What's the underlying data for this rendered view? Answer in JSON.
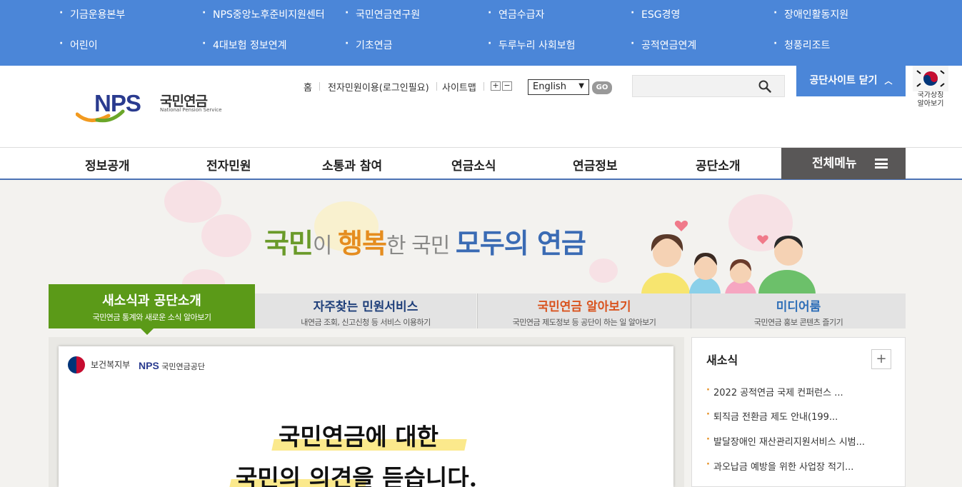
{
  "top_sites": [
    [
      "기금운용본부",
      "NPS중앙노후준비지원센터",
      "국민연금연구원",
      "연금수급자",
      "ESG경영",
      "장애인활동지원"
    ],
    [
      "어린이",
      "4대보험 정보연계",
      "기초연금",
      "두루누리 사회보험",
      "공적연금연계",
      "청풍리조트"
    ]
  ],
  "logo": {
    "nps": "NPS",
    "kr": "국민연금",
    "en": "National Pension Service"
  },
  "util": {
    "home": "홈",
    "eservice": "전자민원이용(로그인필요)",
    "sitemap": "사이트맵",
    "font_plus": "+",
    "font_minus": "−",
    "language": "English",
    "go": "GO",
    "close_site": "공단사이트 닫기",
    "symbol_line1": "국가상징",
    "symbol_line2": "알아보기"
  },
  "gnb": [
    "정보공개",
    "전자민원",
    "소통과 참여",
    "연금소식",
    "연금정보",
    "공단소개"
  ],
  "all_menu": "전체메뉴",
  "slogan": {
    "p1": "국민",
    "p2": "이 ",
    "p3": "행복",
    "p4": "한 국민 ",
    "p5": "모두의 연금"
  },
  "tabs": [
    {
      "title": "새소식과 공단소개",
      "desc": "국민연금 통계와 새로운 소식 알아보기",
      "color": "#ffffff"
    },
    {
      "title": "자주찾는 민원서비스",
      "desc": "내연금 조회, 신고신청 등 서비스 이용하기",
      "color": "#1f3f7a"
    },
    {
      "title": "국민연금 알아보기",
      "desc": "국민연금 제도정보 등 공단이 하는 일 알아보기",
      "color": "#d9531e"
    },
    {
      "title": "미디어룸",
      "desc": "국민연금 홍보 콘텐츠 즐기기",
      "color": "#2f6fb8"
    }
  ],
  "poster": {
    "ministry": "보건복지부",
    "nps_mark": "NPS",
    "nps_org": "국민연금공단",
    "headline1": "국민연금에 대한",
    "headline2": "국민의 의견을 듣습니다."
  },
  "news": {
    "title": "새소식",
    "more": "+",
    "items": [
      "2022 공적연금 국제 컨퍼런스 ...",
      "퇴직금 전환금 제도 안내(199...",
      "발달장애인 재산관리지원서비스 시범...",
      "과오납금 예방을 위한 사업장 적기..."
    ]
  }
}
